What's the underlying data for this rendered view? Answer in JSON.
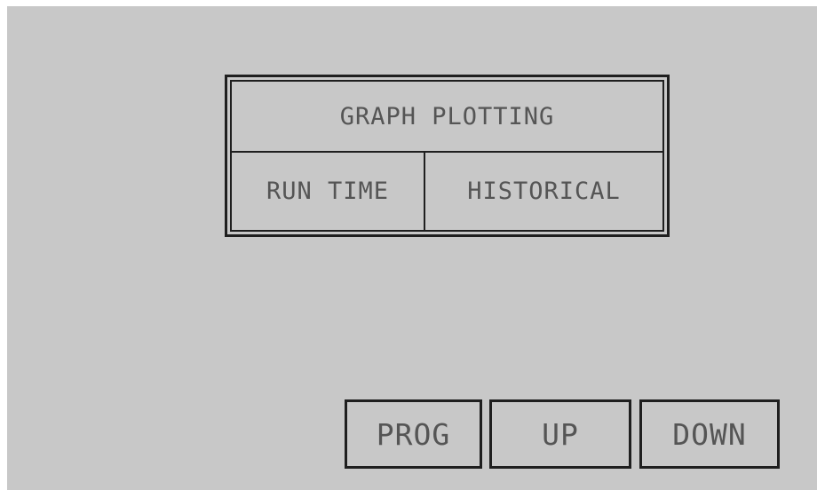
{
  "menu": {
    "title": "GRAPH PLOTTING",
    "options": [
      {
        "label": "RUN TIME"
      },
      {
        "label": "HISTORICAL"
      }
    ]
  },
  "buttons": {
    "prog_label": "PROG",
    "up_label": "UP",
    "down_label": "DOWN"
  },
  "colors": {
    "screen_background": "#c8c8c8",
    "border": "#1f1f1f",
    "text": "#555555"
  }
}
